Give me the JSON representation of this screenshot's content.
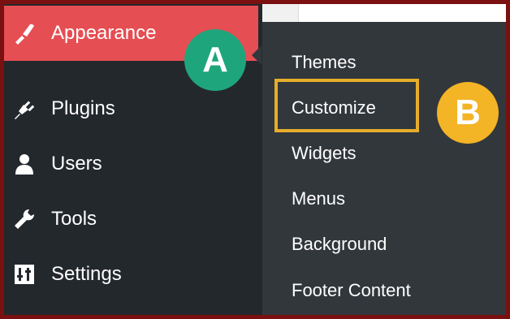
{
  "sidebar": {
    "items": [
      {
        "label": "Appearance",
        "icon": "paintbrush-icon",
        "active": true
      },
      {
        "label": "Plugins",
        "icon": "plug-icon",
        "active": false
      },
      {
        "label": "Users",
        "icon": "user-icon",
        "active": false
      },
      {
        "label": "Tools",
        "icon": "wrench-icon",
        "active": false
      },
      {
        "label": "Settings",
        "icon": "sliders-icon",
        "active": false
      }
    ]
  },
  "submenu": {
    "items": [
      {
        "label": "Themes"
      },
      {
        "label": "Customize",
        "highlighted": true
      },
      {
        "label": "Widgets"
      },
      {
        "label": "Menus"
      },
      {
        "label": "Background"
      },
      {
        "label": "Footer Content"
      }
    ]
  },
  "annotations": {
    "a": "A",
    "b": "B"
  },
  "colors": {
    "sidebar_bg": "#23282d",
    "submenu_bg": "#32373c",
    "active_item": "#e54e53",
    "frame": "#7a1010",
    "badge_a": "#1fa57c",
    "badge_b": "#f3b426",
    "highlight_box": "#e6ad2b"
  }
}
